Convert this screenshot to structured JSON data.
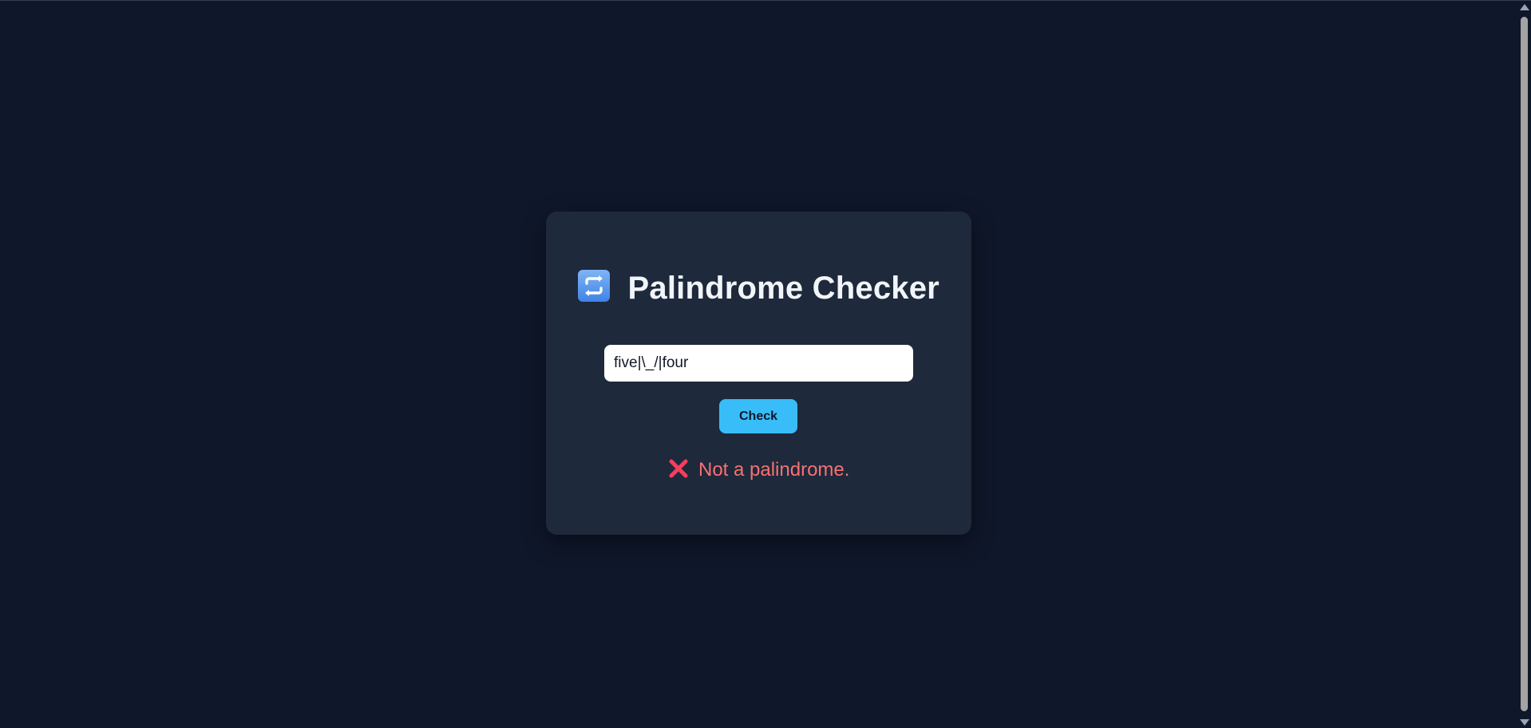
{
  "app": {
    "title": "Palindrome Checker",
    "title_icon": "repeat-icon"
  },
  "form": {
    "input_value": "five|\\_/|four",
    "check_label": "Check"
  },
  "result": {
    "icon": "cross-mark-icon",
    "text": "Not a palindrome.",
    "color": "#f87171"
  },
  "colors": {
    "background": "#0f172a",
    "card": "#1e293b",
    "accent": "#38bdf8"
  }
}
